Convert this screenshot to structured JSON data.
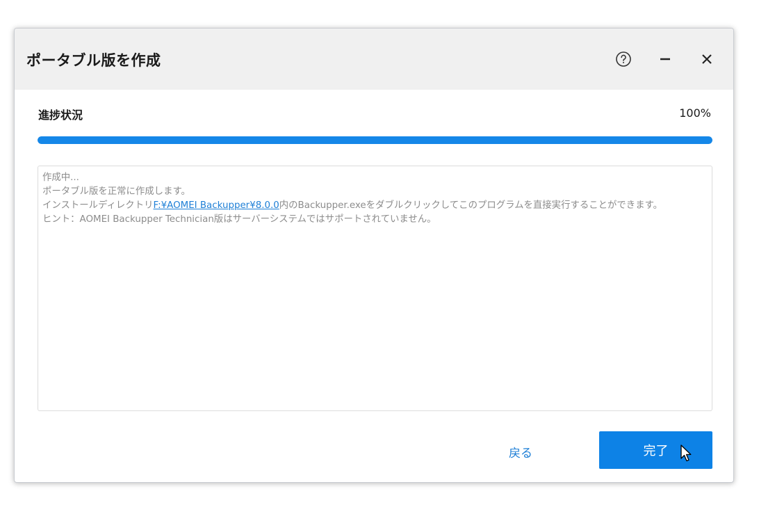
{
  "window": {
    "title": "ポータブル版を作成",
    "controls": [
      "help-icon",
      "minimize-icon",
      "close-icon"
    ]
  },
  "progress": {
    "label": "進捗状況",
    "percent_text": "100%",
    "value": 100
  },
  "log": {
    "line1": "作成中...",
    "line2": "ポータブル版を正常に作成します。",
    "line3_prefix": "インストールディレクトリ",
    "line3_link": "F:¥AOMEI Backupper¥8.0.0",
    "line3_suffix": "内のBackupper.exeをダブルクリックしてこのプログラムを直接実行することができます。",
    "line4": "ヒント：AOMEI Backupper Technician版はサーバーシステムではサポートされていません。"
  },
  "footer": {
    "back_label": "戻る",
    "finish_label": "完了"
  },
  "colors": {
    "accent": "#0d82e6",
    "link": "#1e7fd6",
    "titlebar_bg": "#f0f0f0",
    "log_text": "#8c8c8c"
  }
}
